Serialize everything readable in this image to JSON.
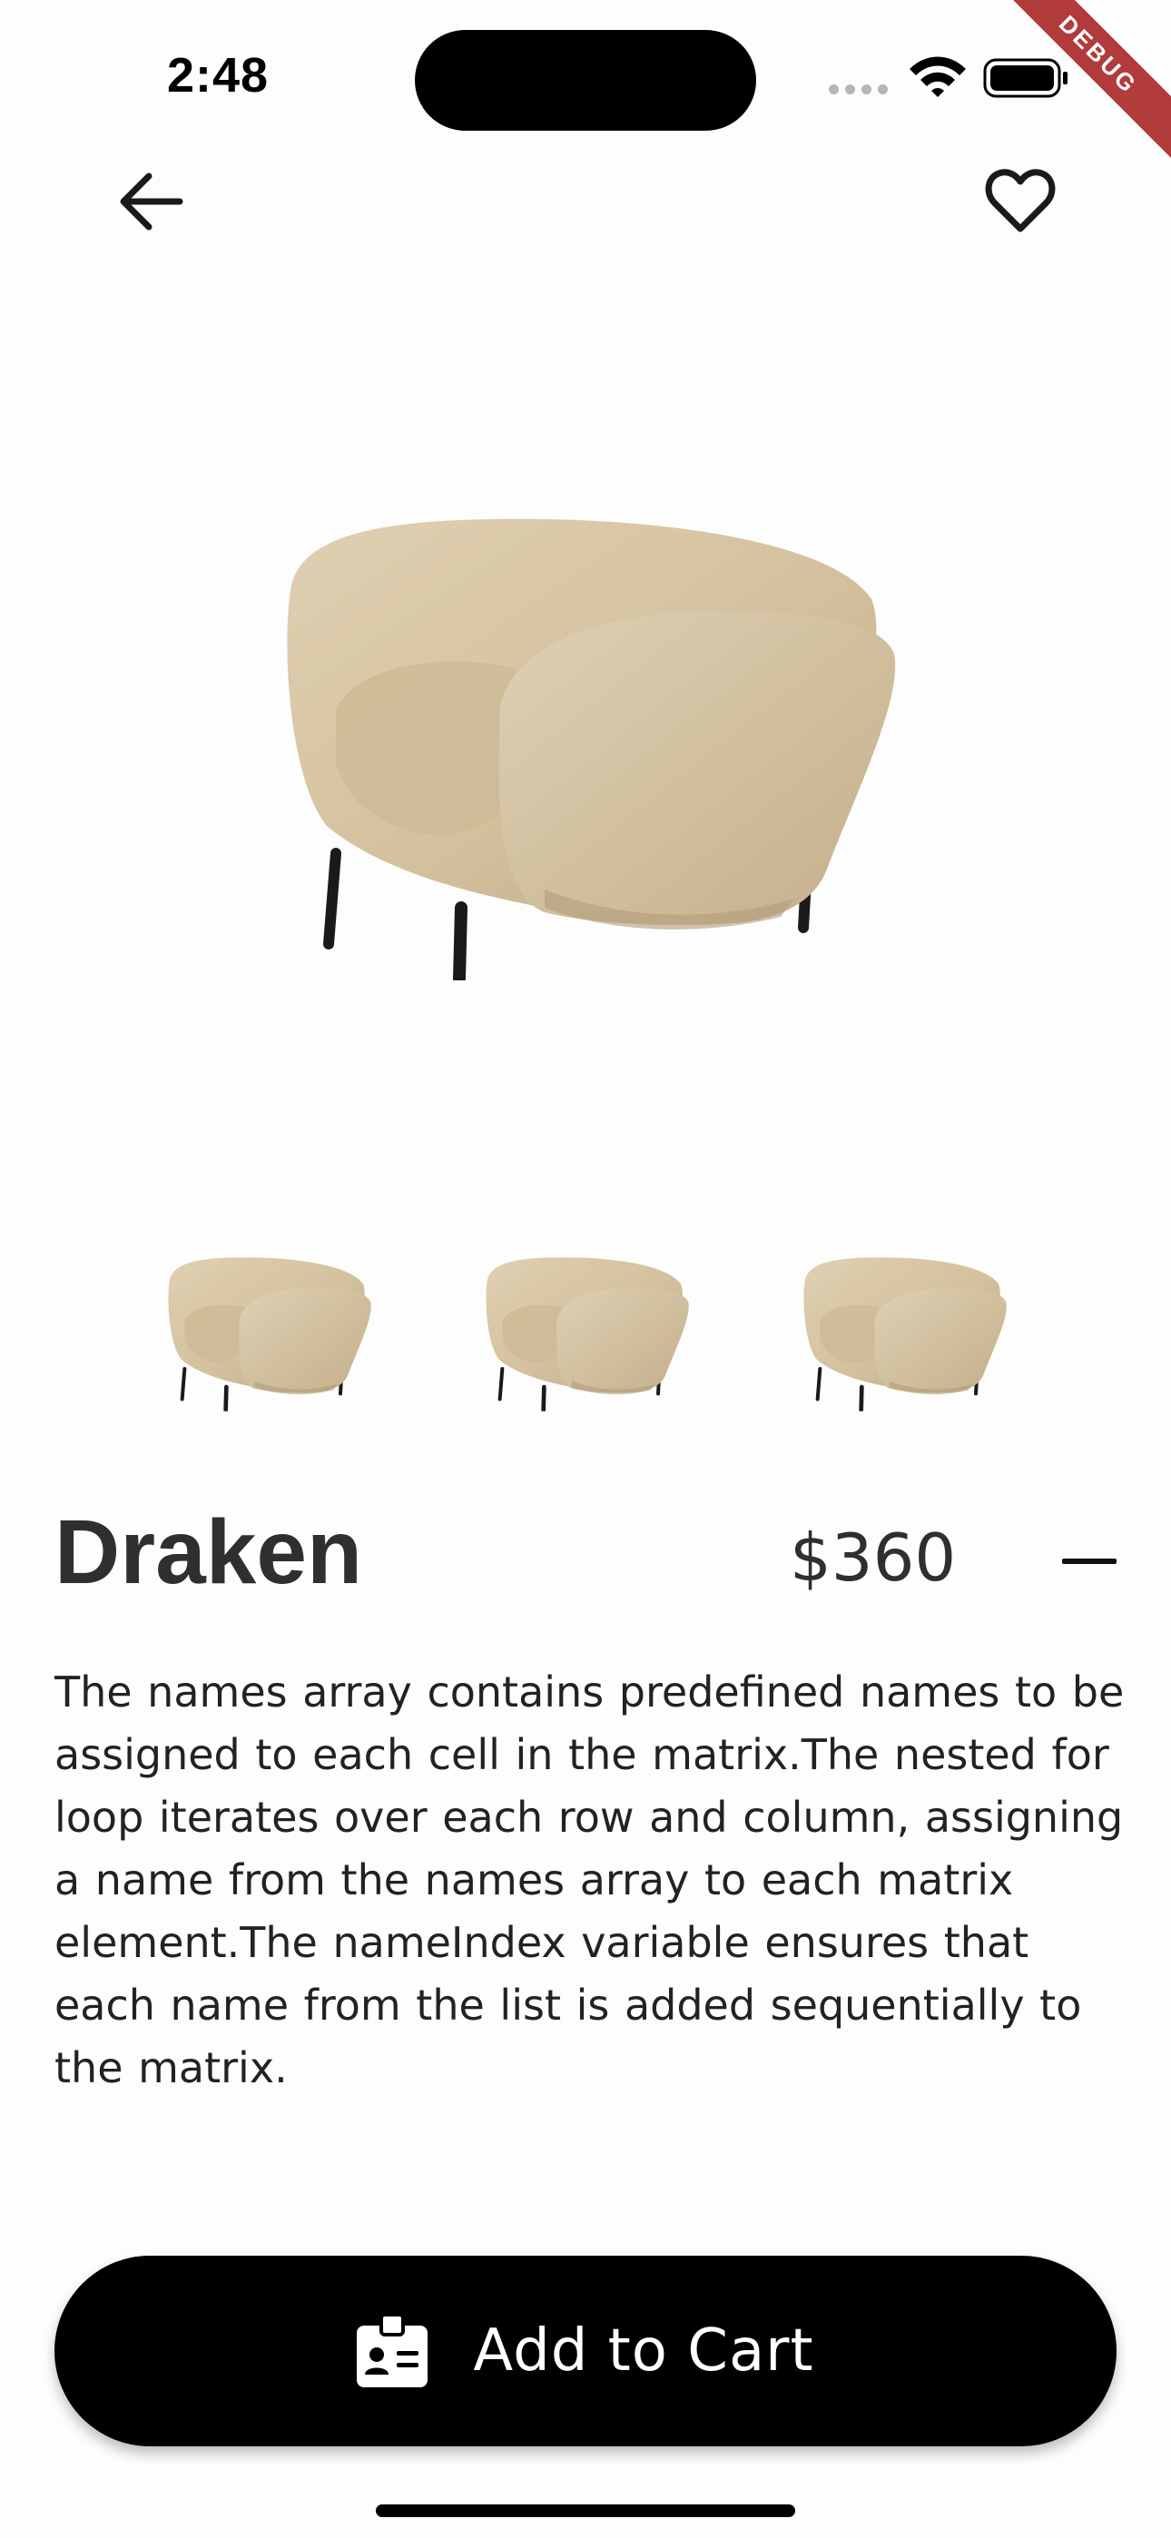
{
  "status_bar": {
    "time": "2:48",
    "debug_label": "DEBUG"
  },
  "icons": {
    "back": "arrow-left-icon",
    "favorite": "heart-outline-icon",
    "wifi": "wifi-icon",
    "battery": "battery-icon",
    "cart": "id-badge-icon",
    "minus": "minus-icon"
  },
  "product": {
    "name": "Draken",
    "price": "$360",
    "description": "The names array contains predefined names to be assigned to each cell in the matrix.The nested for loop iterates over each row and column, assigning a name from the names array to each matrix element.The nameIndex variable ensures that each name from the list is added sequentially to the matrix.",
    "thumbnail_count": 3
  },
  "cta": {
    "label": "Add to Cart"
  },
  "colors": {
    "background": "#fdfdfd",
    "text": "#2f2f2f",
    "button": "#000000",
    "button_text": "#ffffff",
    "sofa": "#d9c7a6",
    "debug_banner": "#b23b3b"
  }
}
